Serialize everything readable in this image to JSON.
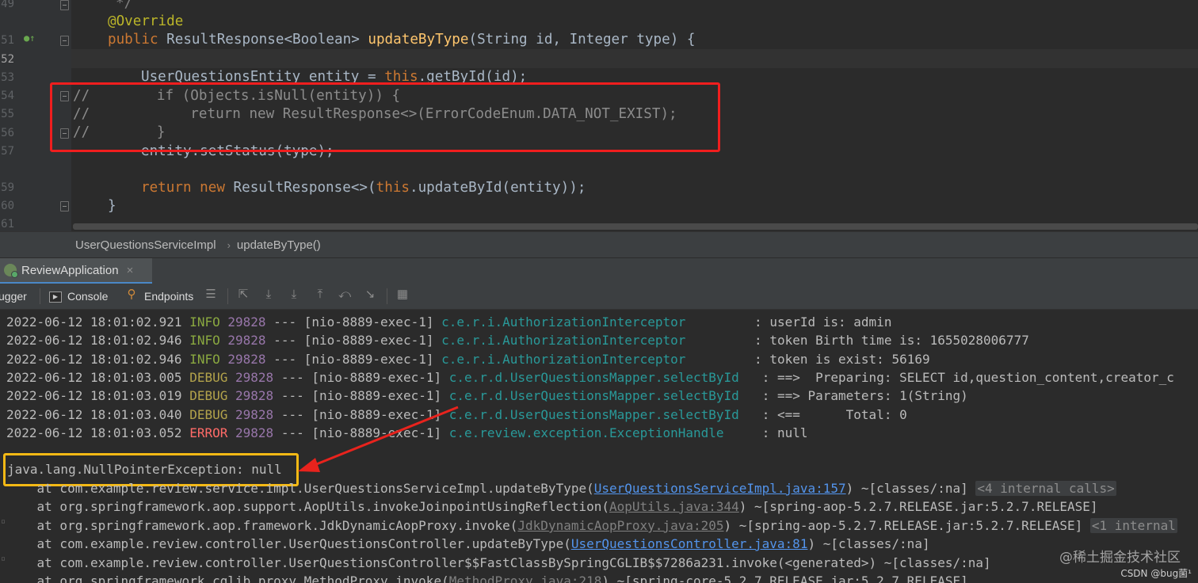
{
  "editor": {
    "line_numbers": [
      "49",
      "51",
      "52",
      "53",
      "54",
      "55",
      "56",
      "57",
      "59",
      "60",
      "61"
    ],
    "lines": {
      "l49": "*/",
      "l50_annotation": "@Override",
      "l51_kw": "public ",
      "l51_type": "ResultResponse<Boolean> ",
      "l51_fn": "updateByType",
      "l51_params_a": "(String id, Integer type) {",
      "l53_a": "UserQuestionsEntity entity = ",
      "l53_this": "this",
      "l53_b": ".getById(id);",
      "l54": "//        if (Objects.isNull(entity)) {",
      "l55": "//            return new ResultResponse<>(ErrorCodeEnum.DATA_NOT_EXIST);",
      "l56": "//        }",
      "l57": "entity.setStatus(type);",
      "l59_kw1": "return new ",
      "l59_a": "ResultResponse<>(",
      "l59_this": "this",
      "l59_b": ".updateById(entity));",
      "l60": "}"
    }
  },
  "breadcrumb": {
    "class_name": "UserQuestionsServiceImpl",
    "method_name": "updateByType()"
  },
  "run_tab": {
    "label": "ReviewApplication",
    "close": "×"
  },
  "console_toolbar": {
    "debugger_label": "ugger",
    "console_label": "Console",
    "endpoints_label": "Endpoints"
  },
  "console": {
    "logs": [
      {
        "ts": "2022-06-12 18:01:02.921",
        "level": " INFO",
        "pid": "29828",
        "thread": " --- [nio-8889-exec-1] ",
        "logger": "c.e.r.i.AuthorizationInterceptor        ",
        "msg": " : userId is: admin"
      },
      {
        "ts": "2022-06-12 18:01:02.946",
        "level": " INFO",
        "pid": "29828",
        "thread": " --- [nio-8889-exec-1] ",
        "logger": "c.e.r.i.AuthorizationInterceptor        ",
        "msg": " : token Birth time is: 1655028006777"
      },
      {
        "ts": "2022-06-12 18:01:02.946",
        "level": " INFO",
        "pid": "29828",
        "thread": " --- [nio-8889-exec-1] ",
        "logger": "c.e.r.i.AuthorizationInterceptor        ",
        "msg": " : token is exist: 56169"
      },
      {
        "ts": "2022-06-12 18:01:03.005",
        "level": "DEBUG",
        "pid": "29828",
        "thread": " --- [nio-8889-exec-1] ",
        "logger": "c.e.r.d.UserQuestionsMapper.selectById  ",
        "msg": " : ==>  Preparing: SELECT id,question_content,creator_c"
      },
      {
        "ts": "2022-06-12 18:01:03.019",
        "level": "DEBUG",
        "pid": "29828",
        "thread": " --- [nio-8889-exec-1] ",
        "logger": "c.e.r.d.UserQuestionsMapper.selectById  ",
        "msg": " : ==> Parameters: 1(String)"
      },
      {
        "ts": "2022-06-12 18:01:03.040",
        "level": "DEBUG",
        "pid": "29828",
        "thread": " --- [nio-8889-exec-1] ",
        "logger": "c.e.r.d.UserQuestionsMapper.selectById  ",
        "msg": " : <==      Total: 0"
      },
      {
        "ts": "2022-06-12 18:01:03.052",
        "level": "ERROR",
        "pid": "29828",
        "thread": " --- [nio-8889-exec-1] ",
        "logger": "c.e.review.exception.ExceptionHandle    ",
        "msg": " : null"
      }
    ],
    "exception": "java.lang.NullPointerException: null",
    "trace": [
      {
        "pre": "    at com.example.review.service.impl.UserQuestionsServiceImpl.updateByType(",
        "link": "UserQuestionsServiceImpl.java:157",
        "post": ") ~[classes/:na] ",
        "internal": "<4 internal calls>",
        "style": "link"
      },
      {
        "pre": "    at org.springframework.aop.support.AopUtils.invokeJoinpointUsingReflection(",
        "link": "AopUtils.java:344",
        "post": ") ~[spring-aop-5.2.7.RELEASE.jar:5.2.7.RELEASE]",
        "internal": "",
        "style": "glink"
      },
      {
        "pre": "    at org.springframework.aop.framework.JdkDynamicAopProxy.invoke(",
        "link": "JdkDynamicAopProxy.java:205",
        "post": ") ~[spring-aop-5.2.7.RELEASE.jar:5.2.7.RELEASE] ",
        "internal": "<1 internal",
        "style": "glink"
      },
      {
        "pre": "    at com.example.review.controller.UserQuestionsController.updateByType(",
        "link": "UserQuestionsController.java:81",
        "post": ") ~[classes/:na]",
        "internal": "",
        "style": "link"
      },
      {
        "pre": "    at com.example.review.controller.UserQuestionsController$$FastClassBySpringCGLIB$$7286a231.invoke(<generated>) ~[classes/:na]",
        "link": "",
        "post": "",
        "internal": "",
        "style": "link"
      },
      {
        "pre": "    at org.springframework.cglib.proxy.MethodProxy.invoke(",
        "link": "MethodProxy.java:218",
        "post": ") ~[spring-core-5.2.7.RELEASE.jar:5.2.7.RELEASE]",
        "internal": "",
        "style": "glink"
      }
    ]
  },
  "watermark": {
    "main": "@稀土掘金技术社区",
    "sub": "CSDN @bug菌¹"
  },
  "colors": {
    "highlight_red": "#f01e1e",
    "highlight_yellow": "#f5b915",
    "arrow_red": "#e8231d"
  }
}
